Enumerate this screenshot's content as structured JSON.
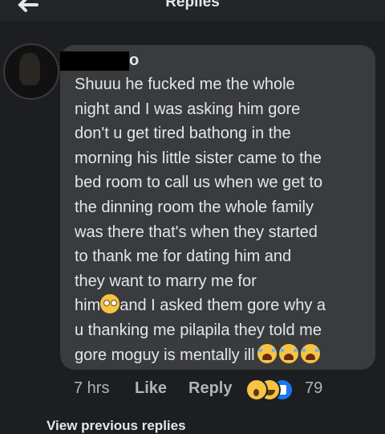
{
  "header": {
    "title": "Replies"
  },
  "comment": {
    "author_suffix": "o",
    "text_lines": [
      "Shuuu he fucked me the whole",
      "night and I was asking him gore",
      "don't u get tired bathong in the",
      "morning his little sister came to the",
      "bed room to call us when we get to",
      "the dinning room the whole family",
      "was there that's when they started",
      "to thank me for dating him    and",
      "they want to marry me for",
      "him",
      "and I asked them gore why a",
      "u thanking me pilapila they told me",
      "gore moguy is mentally ill"
    ]
  },
  "actions": {
    "time": "7 hrs",
    "like": "Like",
    "reply": "Reply",
    "reaction_count": "79",
    "reactions": [
      "wow",
      "haha",
      "like"
    ]
  },
  "footer": {
    "view_previous": "View previous replies"
  },
  "colors": {
    "background": "#1c1e21",
    "bubble": "#3a3b3c",
    "text": "#e4e6eb",
    "muted": "#b0b3b8"
  }
}
